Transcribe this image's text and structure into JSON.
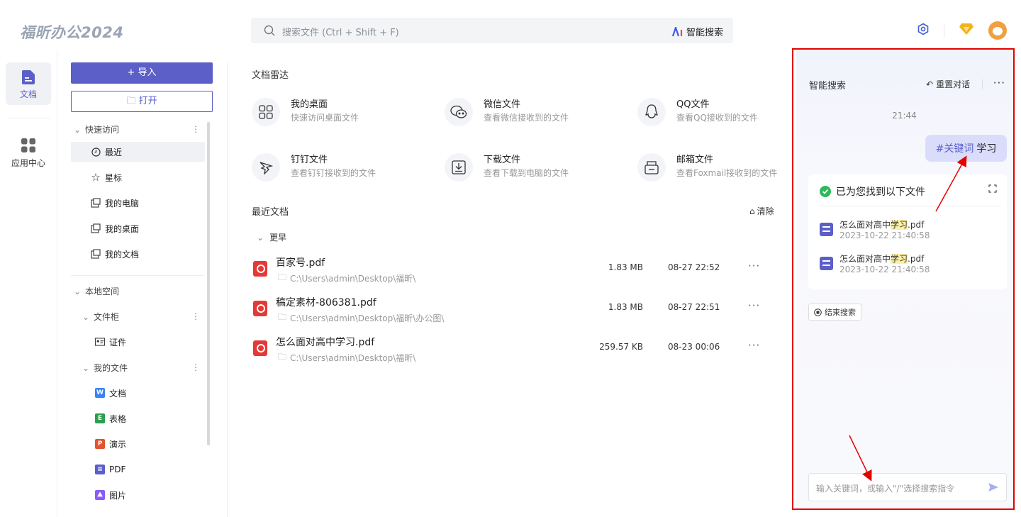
{
  "app": {
    "logo": "福昕办公2024"
  },
  "search": {
    "placeholder": "搜索文件 (Ctrl + Shift + F)",
    "ai_label": "智能搜索"
  },
  "nav": {
    "doc": "文档",
    "apps": "应用中心"
  },
  "sidebar": {
    "import": "+ 导入",
    "open": "打开",
    "quick_access": "快速访问",
    "quick_items": [
      "最近",
      "星标",
      "我的电脑",
      "我的桌面",
      "我的文档"
    ],
    "local_space": "本地空间",
    "cabinet": "文件柜",
    "cabinet_items": [
      "证件"
    ],
    "my_files": "我的文件",
    "file_types": [
      {
        "label": "文档",
        "tag": "W",
        "color": "#3b82f6"
      },
      {
        "label": "表格",
        "tag": "E",
        "color": "#2e9e4f"
      },
      {
        "label": "演示",
        "tag": "P",
        "color": "#e2532e"
      },
      {
        "label": "PDF",
        "tag": "≡",
        "color": "#5b5fc7"
      },
      {
        "label": "图片",
        "tag": "⛰",
        "color": "#8b5cf6"
      }
    ]
  },
  "main": {
    "radar_title": "文档雷达",
    "radar": [
      {
        "title": "我的桌面",
        "sub": "快速访问桌面文件",
        "icon": "grid-icon"
      },
      {
        "title": "微信文件",
        "sub": "查看微信接收到的文件",
        "icon": "wechat-icon"
      },
      {
        "title": "QQ文件",
        "sub": "查看QQ接收到的文件",
        "icon": "qq-icon"
      },
      {
        "title": "钉钉文件",
        "sub": "查看钉钉接收到的文件",
        "icon": "dingtalk-icon"
      },
      {
        "title": "下载文件",
        "sub": "查看下载到电脑的文件",
        "icon": "download-icon"
      },
      {
        "title": "邮箱文件",
        "sub": "查看Foxmail接收到的文件",
        "icon": "mail-icon"
      }
    ],
    "recent_title": "最近文档",
    "clear": "清除",
    "group": "更早",
    "files": [
      {
        "name": "百家号.pdf",
        "path": "C:\\Users\\admin\\Desktop\\福昕\\",
        "size": "1.83 MB",
        "date": "08-27 22:52"
      },
      {
        "name": "稿定素材-806381.pdf",
        "path": "C:\\Users\\admin\\Desktop\\福昕\\办公图\\",
        "size": "1.83 MB",
        "date": "08-27 22:51"
      },
      {
        "name": "怎么面对高中学习.pdf",
        "path": "C:\\Users\\admin\\Desktop\\福昕\\",
        "size": "259.57 KB",
        "date": "08-23 00:06"
      }
    ]
  },
  "panel": {
    "title": "智能搜索",
    "reset": "重置对话",
    "time": "21:44",
    "query_keyword": "#关键词",
    "query_text": "学习",
    "found": "已为您找到以下文件",
    "results": [
      {
        "pre": "怎么面对高中",
        "hl": "学习",
        "post": ".pdf",
        "time": "2023-10-22 21:40:58"
      },
      {
        "pre": "怎么面对高中",
        "hl": "学习",
        "post": ".pdf",
        "time": "2023-10-22 21:40:58"
      }
    ],
    "end": "结束搜索",
    "input_placeholder": "输入关键词，或输入\"/\"选择搜索指令",
    "accent": "#5b5fc7",
    "highlight": "#e50000"
  }
}
